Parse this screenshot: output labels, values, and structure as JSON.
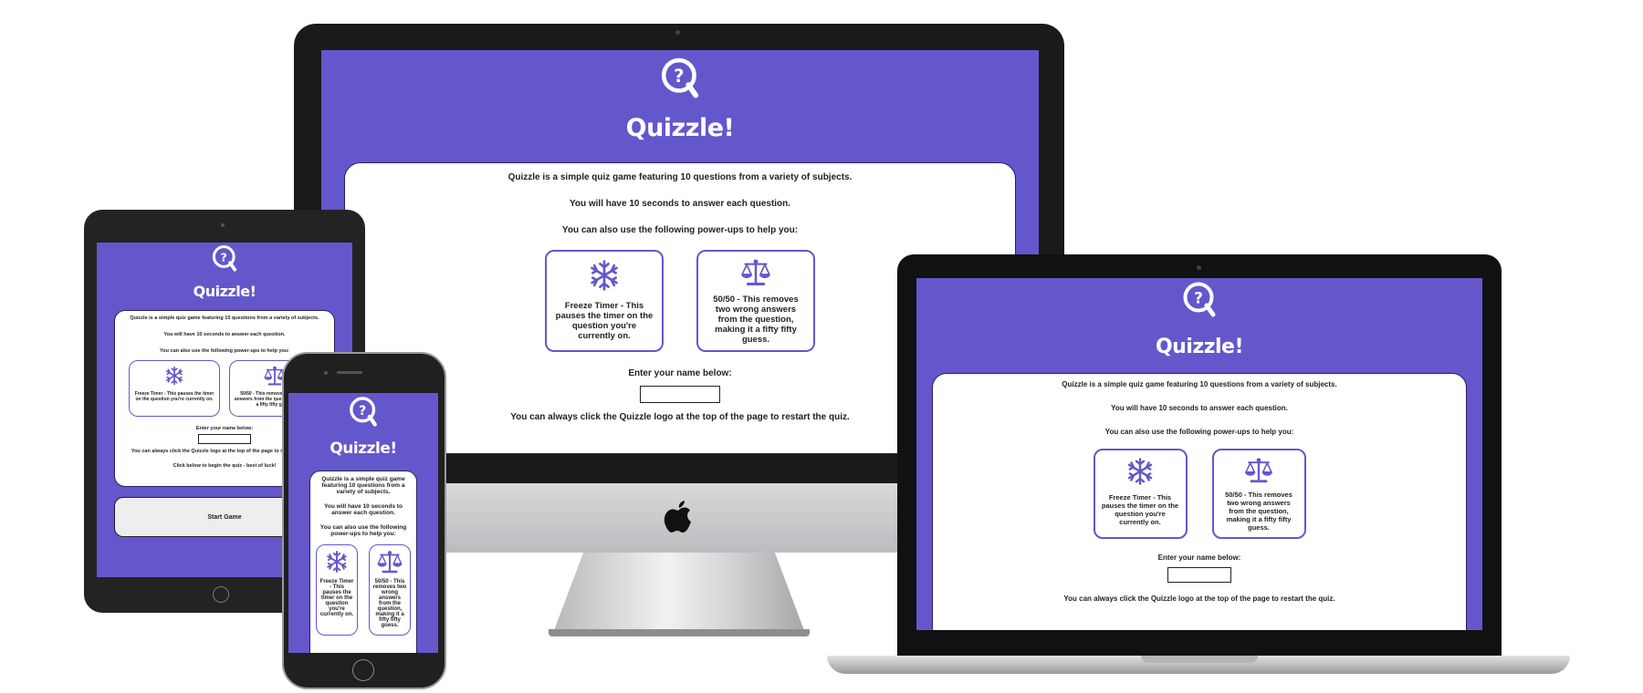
{
  "app": {
    "title": "Quizzle!",
    "intro": "Quizzle is a simple quiz game featuring 10 questions from a variety of subjects.",
    "seconds": "You will have 10 seconds to answer each question.",
    "powerups_intro": "You can also use the following power-ups to help you:",
    "freeze_text": "Freeze Timer - This pauses the timer on the question you're currently on.",
    "fifty_text": "50/50 - This removes two wrong answers from the question, making it a fifty fifty guess.",
    "name_label": "Enter your name below:",
    "restart_text": "You can always click the Quizzle logo at the top of the page to restart the quiz.",
    "begin_text": "Click below to begin the quiz - best of luck!",
    "start_button": "Start Game"
  },
  "icons": [
    "question-logo-icon",
    "snowflake-icon",
    "scales-icon",
    "apple-logo-icon"
  ],
  "colors": {
    "brand": "#6457cc",
    "card": "#ffffff",
    "device_dark": "#1a1a1a"
  }
}
